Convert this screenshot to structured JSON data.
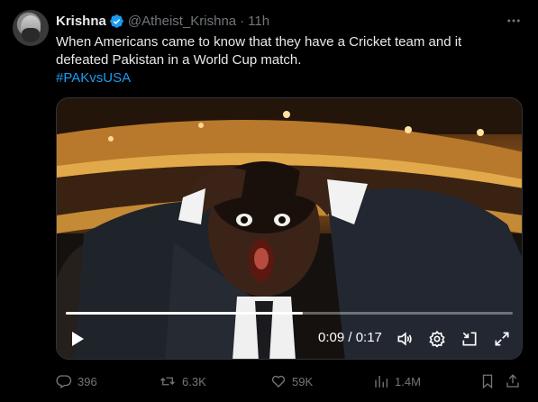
{
  "author": {
    "name": "Krishna",
    "handle": "@Atheist_Krishna",
    "separator": "·",
    "time": "11h"
  },
  "tweet": {
    "line1": "When Americans came to know that they have a Cricket team and it",
    "line2": "defeated Pakistan in a World Cup match.",
    "hashtag": "#PAKvsUSA"
  },
  "video": {
    "time_display": "0:09 / 0:17",
    "progress": 0.53
  },
  "actions": {
    "replies": "396",
    "reposts": "6.3K",
    "likes": "59K",
    "views": "1.4M"
  },
  "colors": {
    "accent": "#1d9bf0",
    "muted": "#71767b",
    "text": "#e7e9ea",
    "background": "#000000"
  },
  "icons": [
    "more-icon",
    "verified-icon",
    "play-icon",
    "volume-icon",
    "settings-icon",
    "minimize-icon",
    "fullscreen-icon",
    "reply-icon",
    "repost-icon",
    "like-icon",
    "views-icon",
    "bookmark-icon",
    "share-icon"
  ]
}
